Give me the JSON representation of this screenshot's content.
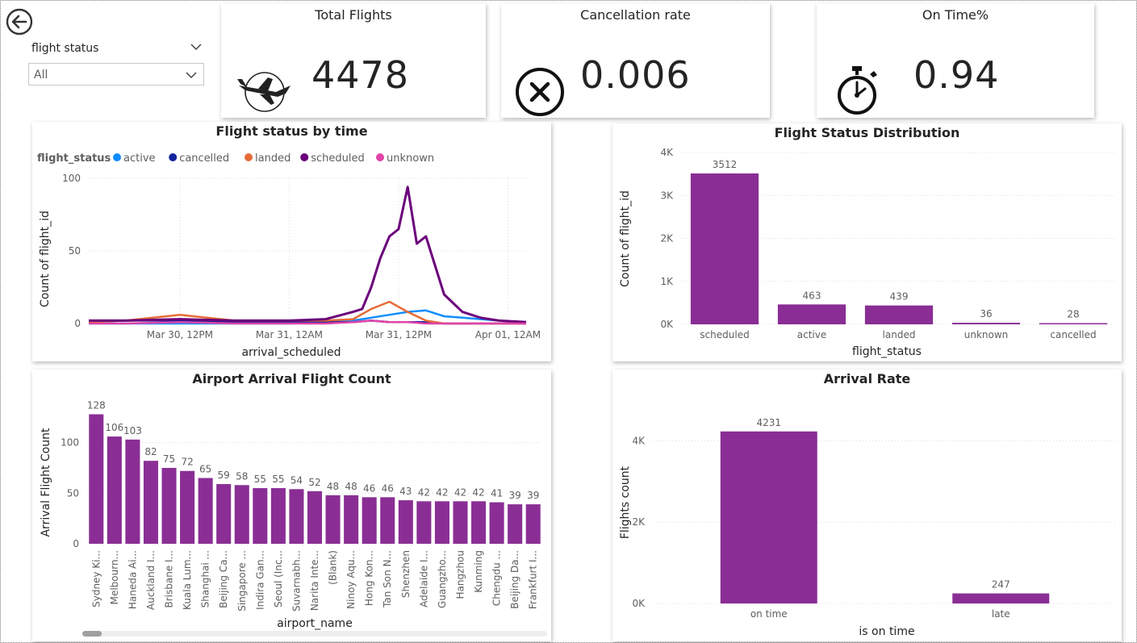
{
  "slicer": {
    "label": "flight status",
    "value": "All"
  },
  "kpis": {
    "total_flights": {
      "title": "Total Flights",
      "value": "4478",
      "icon": "airplane-icon"
    },
    "cancellation": {
      "title": "Cancellation rate",
      "value": "0.006",
      "icon": "cancel-circle-icon"
    },
    "on_time": {
      "title": "On Time%",
      "value": "0.94",
      "icon": "stopwatch-icon"
    }
  },
  "titles": {
    "status_by_time": "Flight status by time",
    "distribution": "Flight Status Distribution",
    "airport": "Airport Arrival Flight Count",
    "arrival_rate": "Arrival Rate"
  },
  "chart_data": [
    {
      "id": "status_by_time",
      "type": "line",
      "title": "Flight status by time",
      "xlabel": "arrival_scheduled",
      "ylabel": "Count of flight_id",
      "ylim": [
        0,
        100
      ],
      "yticks": [
        "0",
        "50",
        "100"
      ],
      "xticks": [
        "Mar 30, 12PM",
        "Mar 31, 12AM",
        "Mar 31, 12PM",
        "Apr 01, 12AM"
      ],
      "xlim": [
        "Mar 30, 2AM",
        "Apr 01, 2AM"
      ],
      "legend_title": "flight_status",
      "legend_position": "top-left",
      "grid": true,
      "series": [
        {
          "name": "active",
          "color": "#118DFF",
          "x": [
            "Mar 30, 2AM",
            "Mar 30, 6AM",
            "Mar 30, 12PM",
            "Mar 30, 6PM",
            "Mar 31, 12AM",
            "Mar 31, 4AM",
            "Mar 31, 7AM",
            "Mar 31, 9AM",
            "Mar 31, 11AM",
            "Mar 31, 1PM",
            "Mar 31, 3PM",
            "Mar 31, 5PM",
            "Mar 31, 7PM",
            "Mar 31, 9PM",
            "Mar 31, 11PM",
            "Apr 01, 2AM"
          ],
          "y": [
            0,
            0,
            0,
            0,
            0,
            1,
            2,
            4,
            6,
            8,
            9,
            5,
            4,
            3,
            2,
            1
          ]
        },
        {
          "name": "cancelled",
          "color": "#12239E",
          "x": [
            "Mar 30, 2AM",
            "Mar 30, 6AM",
            "Mar 30, 12PM",
            "Mar 30, 6PM",
            "Mar 31, 12AM",
            "Mar 31, 4AM",
            "Mar 31, 7AM",
            "Mar 31, 9AM",
            "Mar 31, 11AM",
            "Mar 31, 1PM",
            "Mar 31, 3PM",
            "Mar 31, 5PM",
            "Mar 31, 7PM",
            "Mar 31, 9PM",
            "Mar 31, 11PM",
            "Apr 01, 2AM"
          ],
          "y": [
            1,
            2,
            2,
            1,
            1,
            1,
            1,
            2,
            1,
            1,
            1,
            0,
            0,
            0,
            0,
            0
          ]
        },
        {
          "name": "landed",
          "color": "#E66C37",
          "x": [
            "Mar 30, 2AM",
            "Mar 30, 6AM",
            "Mar 30, 12PM",
            "Mar 30, 6PM",
            "Mar 31, 12AM",
            "Mar 31, 4AM",
            "Mar 31, 7AM",
            "Mar 31, 9AM",
            "Mar 31, 11AM",
            "Mar 31, 1PM",
            "Mar 31, 3PM",
            "Mar 31, 5PM",
            "Mar 31, 7PM",
            "Mar 31, 9PM",
            "Mar 31, 11PM",
            "Apr 01, 2AM"
          ],
          "y": [
            1,
            2,
            6,
            2,
            2,
            2,
            3,
            10,
            15,
            8,
            2,
            0,
            0,
            0,
            0,
            0
          ]
        },
        {
          "name": "scheduled",
          "color": "#6B007B",
          "x": [
            "Mar 30, 2AM",
            "Mar 30, 6AM",
            "Mar 30, 12PM",
            "Mar 30, 6PM",
            "Mar 31, 12AM",
            "Mar 31, 4AM",
            "Mar 31, 7AM",
            "Mar 31, 8AM",
            "Mar 31, 9AM",
            "Mar 31, 10AM",
            "Mar 31, 11AM",
            "Mar 31, 12PM",
            "Mar 31, 1PM",
            "Mar 31, 2PM",
            "Mar 31, 3PM",
            "Mar 31, 4PM",
            "Mar 31, 5PM",
            "Mar 31, 7PM",
            "Mar 31, 9PM",
            "Mar 31, 11PM",
            "Apr 01, 2AM"
          ],
          "y": [
            2,
            2,
            3,
            2,
            2,
            3,
            8,
            10,
            25,
            45,
            60,
            65,
            94,
            55,
            60,
            40,
            20,
            8,
            4,
            2,
            1
          ]
        },
        {
          "name": "unknown",
          "color": "#E044A7",
          "x": [
            "Mar 30, 2AM",
            "Mar 30, 6AM",
            "Mar 30, 12PM",
            "Mar 30, 6PM",
            "Mar 31, 12AM",
            "Mar 31, 4AM",
            "Mar 31, 7AM",
            "Mar 31, 9AM",
            "Mar 31, 11AM",
            "Mar 31, 1PM",
            "Mar 31, 3PM",
            "Mar 31, 5PM",
            "Mar 31, 7PM",
            "Mar 31, 9PM",
            "Mar 31, 11PM",
            "Apr 01, 2AM"
          ],
          "y": [
            0,
            0,
            1,
            0,
            0,
            0,
            1,
            2,
            1,
            1,
            0,
            0,
            0,
            0,
            0,
            0
          ]
        }
      ]
    },
    {
      "id": "distribution",
      "type": "bar",
      "title": "Flight Status Distribution",
      "xlabel": "flight_status",
      "ylabel": "Count of flight_id",
      "ylim": [
        0,
        4000
      ],
      "yticks": [
        "0K",
        "1K",
        "2K",
        "3K",
        "4K"
      ],
      "categories": [
        "scheduled",
        "active",
        "landed",
        "unknown",
        "cancelled"
      ],
      "values": [
        3512,
        463,
        439,
        36,
        28
      ],
      "color": "#8A2E95",
      "grid": true
    },
    {
      "id": "airport",
      "type": "bar",
      "title": "Airport Arrival Flight Count",
      "xlabel": "airport_name",
      "ylabel": "Arrival Flight Count",
      "ylim": [
        0,
        130
      ],
      "yticks": [
        "0",
        "50",
        "100"
      ],
      "categories": [
        "Sydney Ki...",
        "Melbourn...",
        "Haneda Ai...",
        "Auckland I...",
        "Brisbane I...",
        "Kuala Lum...",
        "Shanghai ...",
        "Beijing Ca...",
        "Singapore ...",
        "Indira Gan...",
        "Seoul (Inc...",
        "Suvarnabh...",
        "Narita Inte...",
        "(Blank)",
        "Ninoy Aqu...",
        "Hong Kon...",
        "Tan Son N...",
        "Shenzhen",
        "Adelaide I...",
        "Guangzho...",
        "Hangzhou",
        "Kunming",
        "Chengdu ...",
        "Beijing Da...",
        "Frankfurt I..."
      ],
      "values": [
        128,
        106,
        103,
        82,
        75,
        72,
        65,
        59,
        58,
        55,
        55,
        54,
        52,
        48,
        48,
        46,
        46,
        43,
        42,
        42,
        42,
        42,
        41,
        39,
        39
      ],
      "color": "#8A2E95",
      "grid": true
    },
    {
      "id": "arrival_rate",
      "type": "bar",
      "title": "Arrival Rate",
      "xlabel": "is on time",
      "ylabel": "Flights count",
      "ylim": [
        0,
        5000
      ],
      "yticks": [
        "0K",
        "2K",
        "4K"
      ],
      "categories": [
        "on time",
        "late"
      ],
      "values": [
        4231,
        247
      ],
      "color": "#8A2E95",
      "grid": true
    }
  ]
}
